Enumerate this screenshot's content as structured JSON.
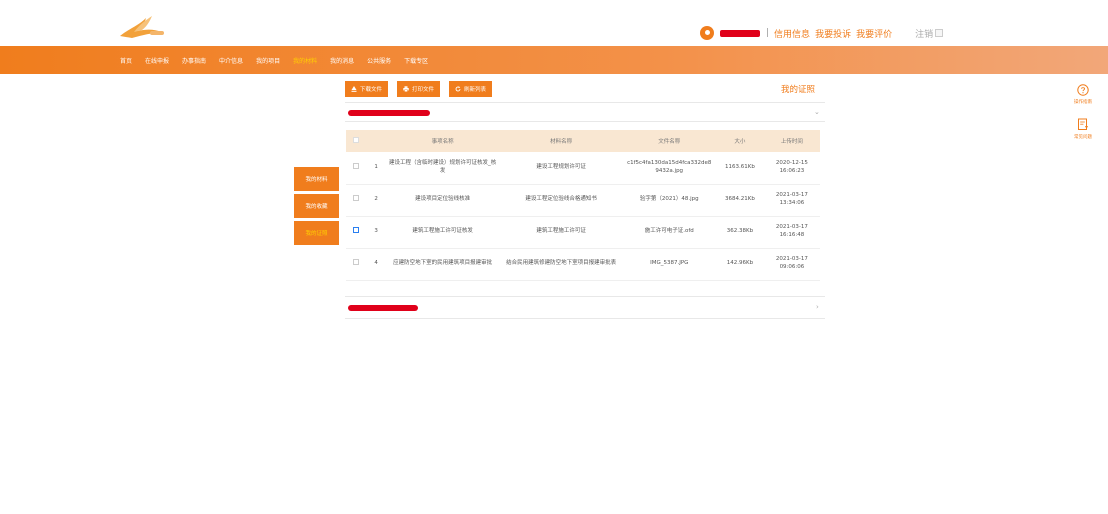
{
  "top": {
    "links": [
      "信用信息",
      "我要投诉",
      "我要评价"
    ],
    "separator": "|",
    "logout": "注销"
  },
  "nav": {
    "items": [
      "首页",
      "在线申报",
      "办事指南",
      "中介信息",
      "我的项目",
      "我的材料",
      "我的消息",
      "公共服务",
      "下载专区"
    ],
    "active_index": 5
  },
  "toolbar": {
    "download": "下载文件",
    "print": "打印文件",
    "refresh": "刷新列表"
  },
  "section_title": "我的证照",
  "side_menu": {
    "items": [
      "我的材料",
      "我的收藏",
      "我的证照"
    ],
    "active_index": 2
  },
  "table": {
    "headers": [
      "",
      "",
      "事项名称",
      "材料名称",
      "文件名称",
      "大小",
      "上传时间"
    ],
    "rows": [
      {
        "no": "1",
        "item": "建设工程（含临时建设）规划许可证核发_核发",
        "material": "建设工程规划许可证",
        "file": "c1f5c4fa130da15d4fca332de89432a.jpg",
        "size": "1163.61Kb",
        "time": "2020-12-15 16:06:23",
        "checkbox": "gray"
      },
      {
        "no": "2",
        "item": "建设项目定位验线核准",
        "material": "建设工程定位验线合格通知书",
        "file": "验字第（2021）48.jpg",
        "size": "3684.21Kb",
        "time": "2021-03-17 13:34:06",
        "checkbox": "gray"
      },
      {
        "no": "3",
        "item": "建筑工程施工许可证核发",
        "material": "建筑工程施工许可证",
        "file": "施工许可电子证.ofd",
        "size": "362.38Kb",
        "time": "2021-03-17 16:16:48",
        "checkbox": "blue"
      },
      {
        "no": "4",
        "item": "应建防空地下室的民用建筑项目报建审批",
        "material": "结合民用建筑修建防空地下室项目报建审批表",
        "file": "IMG_5387.JPG",
        "size": "142.96Kb",
        "time": "2021-03-17 09:06:06",
        "checkbox": "gray"
      }
    ]
  },
  "right_tools": {
    "guide": "操作指南",
    "faq": "常见问题"
  },
  "colors": {
    "accent": "#f07d1d",
    "active_nav": "#ffd000",
    "table_header": "#f9e7d2",
    "redaction": "#e0001a"
  },
  "icons": [
    "logo-bird-icon",
    "user-icon",
    "download-icon",
    "print-icon",
    "refresh-icon",
    "chevron-down-icon",
    "chevron-right-icon",
    "help-circle-icon",
    "faq-doc-icon"
  ]
}
